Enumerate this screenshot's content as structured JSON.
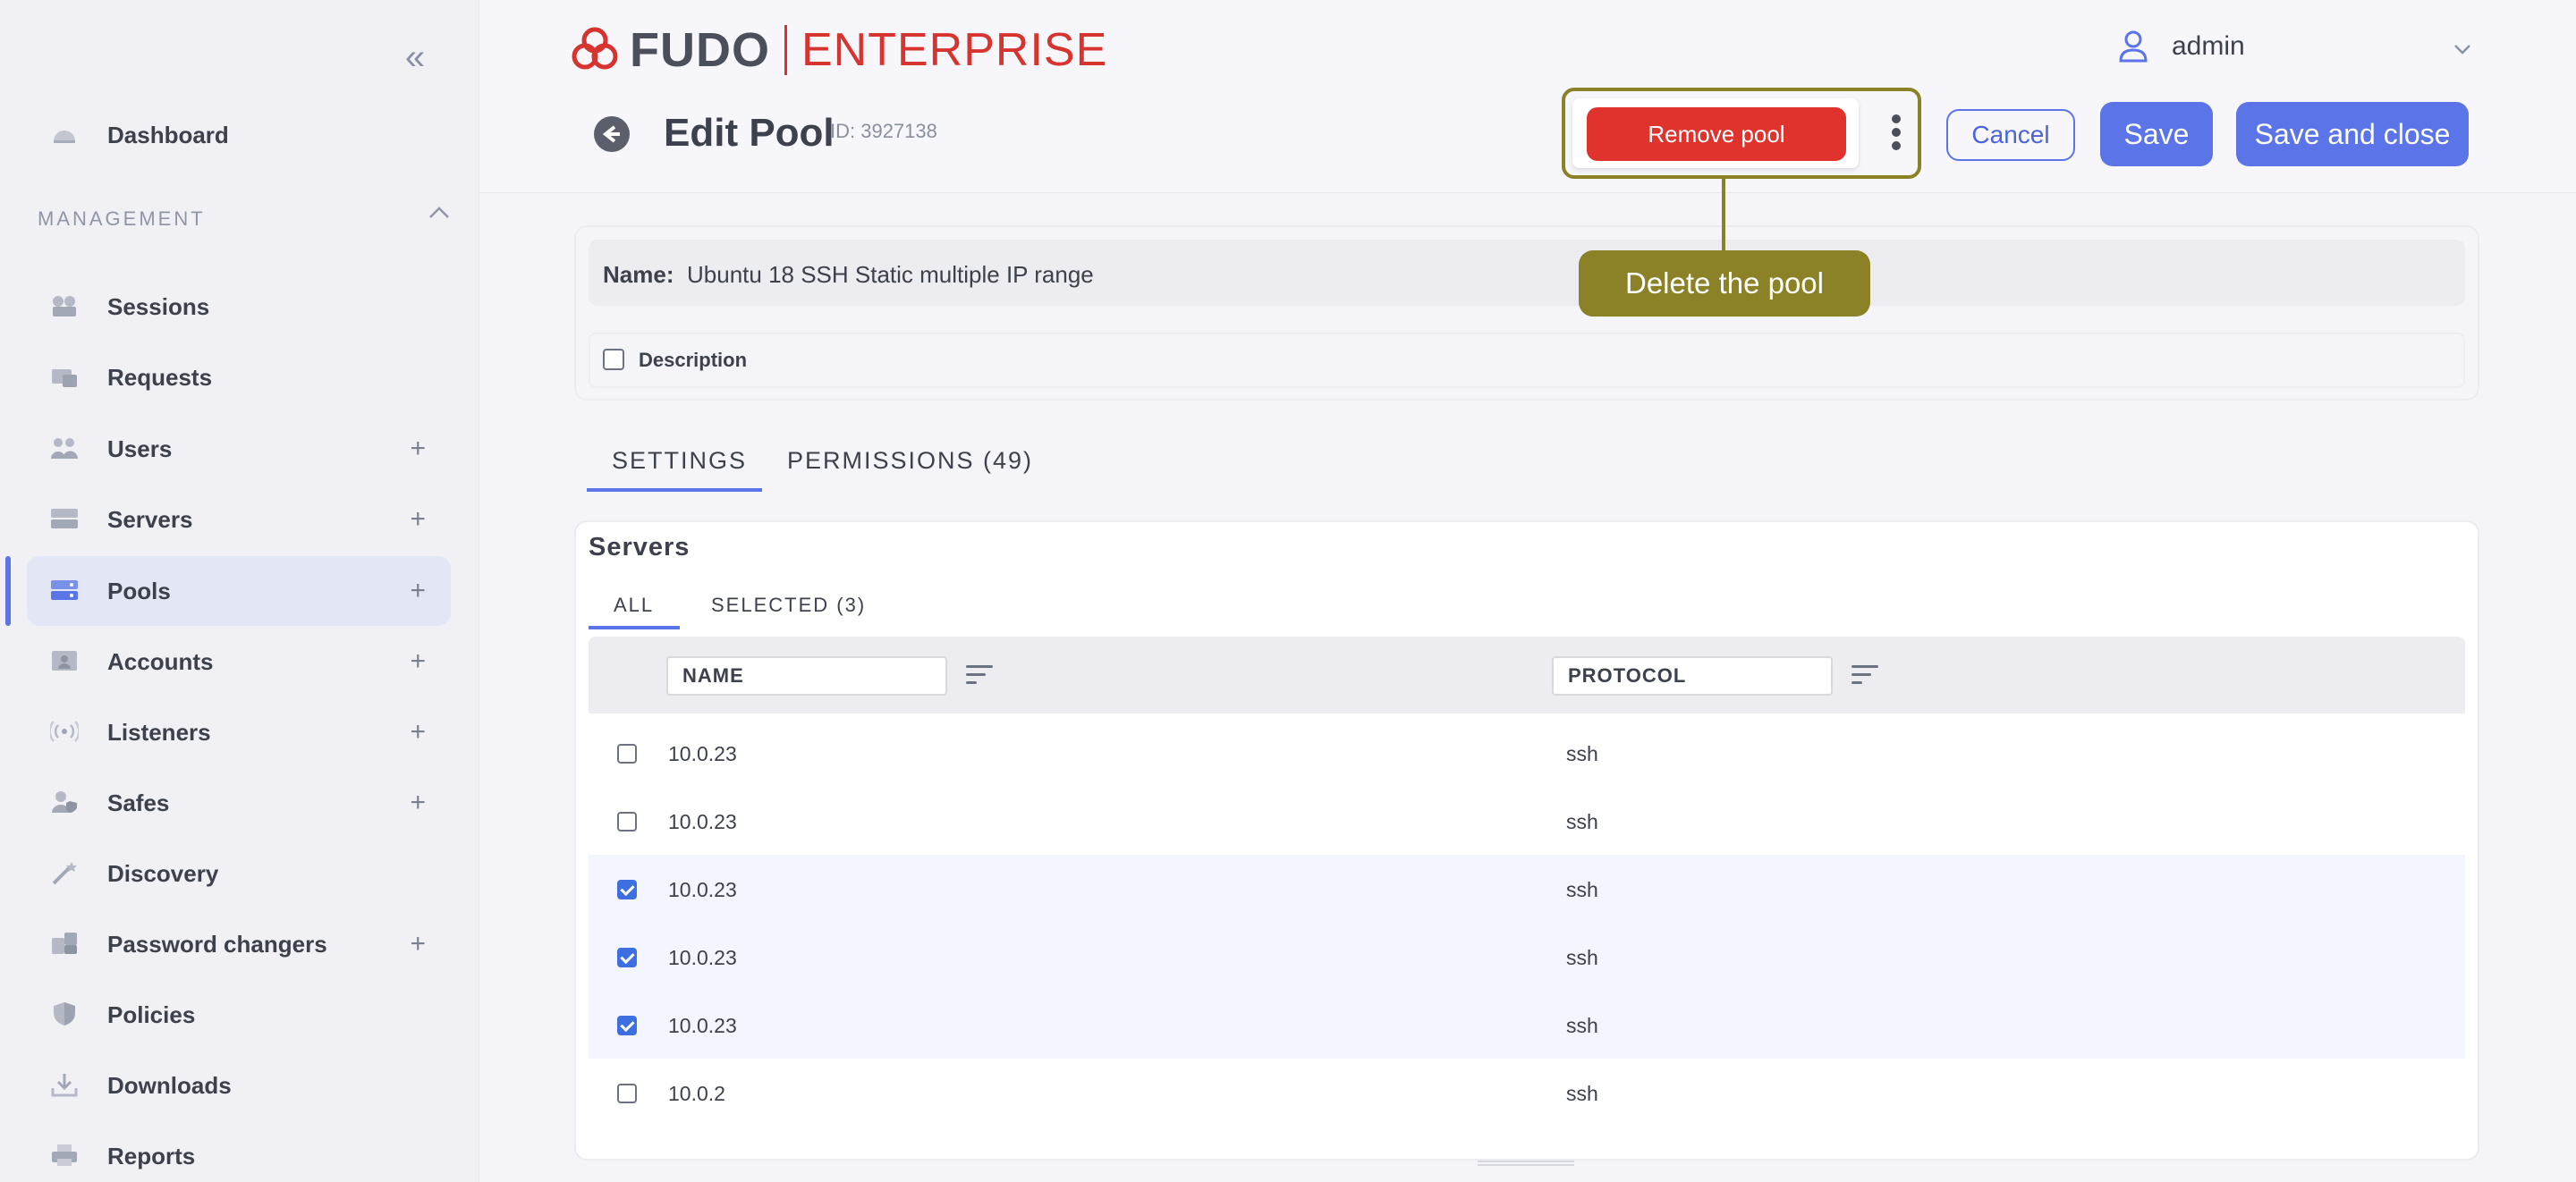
{
  "sidebar": {
    "items": [
      {
        "label": "Dashboard",
        "icon": "dashboard-icon"
      },
      {
        "label": "Sessions",
        "icon": "sessions-icon"
      },
      {
        "label": "Requests",
        "icon": "requests-icon"
      },
      {
        "label": "Users",
        "icon": "users-icon",
        "add": "+"
      },
      {
        "label": "Servers",
        "icon": "servers-icon",
        "add": "+"
      },
      {
        "label": "Pools",
        "icon": "pools-icon",
        "add": "+",
        "active": true
      },
      {
        "label": "Accounts",
        "icon": "accounts-icon",
        "add": "+"
      },
      {
        "label": "Listeners",
        "icon": "listeners-icon",
        "add": "+"
      },
      {
        "label": "Safes",
        "icon": "safes-icon",
        "add": "+"
      },
      {
        "label": "Discovery",
        "icon": "discovery-icon"
      },
      {
        "label": "Password changers",
        "icon": "password-changers-icon",
        "add": "+"
      },
      {
        "label": "Policies",
        "icon": "policies-icon"
      },
      {
        "label": "Downloads",
        "icon": "downloads-icon"
      },
      {
        "label": "Reports",
        "icon": "reports-icon"
      }
    ],
    "section_label": "MANAGEMENT",
    "collapse_glyph": "«"
  },
  "header": {
    "logo_left": "FUDO",
    "logo_right": "ENTERPRISE",
    "user_name": "admin",
    "page_title": "Edit Pool",
    "page_id": "ID: 3927138",
    "remove_label": "Remove pool",
    "cancel_label": "Cancel",
    "save_label": "Save",
    "save_close_label": "Save and close"
  },
  "tooltip": {
    "text": "Delete the pool"
  },
  "form": {
    "name_label": "Name:",
    "name_value": "Ubuntu 18 SSH Static multiple IP range",
    "description_label": "Description"
  },
  "tabs": [
    {
      "label": "SETTINGS",
      "active": true
    },
    {
      "label": "PERMISSIONS (49)"
    }
  ],
  "servers": {
    "title": "Servers",
    "subtabs": [
      {
        "label": "ALL",
        "active": true
      },
      {
        "label": "SELECTED (3)"
      }
    ],
    "columns": [
      "NAME",
      "PROTOCOL"
    ],
    "rows": [
      {
        "name": "10.0.23",
        "protocol": "ssh",
        "checked": false
      },
      {
        "name": "10.0.23",
        "protocol": "ssh",
        "checked": false
      },
      {
        "name": "10.0.23",
        "protocol": "ssh",
        "checked": true
      },
      {
        "name": "10.0.23",
        "protocol": "ssh",
        "checked": true
      },
      {
        "name": "10.0.23",
        "protocol": "ssh",
        "checked": true
      },
      {
        "name": "10.0.2",
        "protocol": "ssh",
        "checked": false
      }
    ]
  },
  "colors": {
    "accent": "#5b74e8",
    "danger": "#e0332d",
    "highlight": "#8b8227",
    "brand_red": "#d7342f"
  }
}
